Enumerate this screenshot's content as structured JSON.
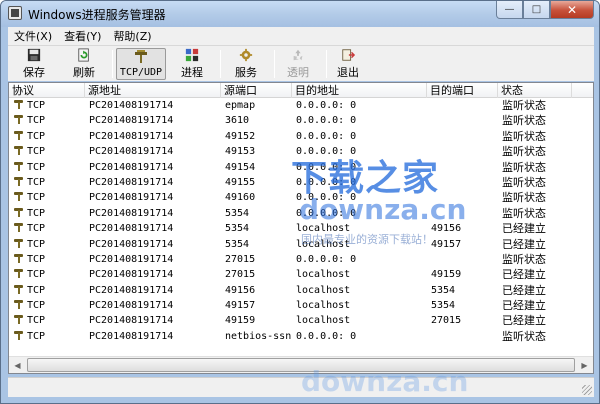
{
  "window": {
    "title": "Windows进程服务管理器"
  },
  "window_buttons": {
    "minimize": "—",
    "maximize": "□",
    "close": "✕"
  },
  "menu": [
    {
      "label": "文件(X)"
    },
    {
      "label": "查看(Y)"
    },
    {
      "label": "帮助(Z)"
    }
  ],
  "toolbar": [
    {
      "label": "保存",
      "icon": "save-icon",
      "state": "normal"
    },
    {
      "label": "刷新",
      "icon": "refresh-icon",
      "state": "normal"
    },
    {
      "label": "TCP/UDP",
      "icon": "network-icon",
      "state": "pressed"
    },
    {
      "label": "进程",
      "icon": "process-icon",
      "state": "normal"
    },
    {
      "label": "服务",
      "icon": "service-icon",
      "state": "normal"
    },
    {
      "label": "透明",
      "icon": "transparency-icon",
      "state": "disabled"
    },
    {
      "label": "退出",
      "icon": "exit-icon",
      "state": "normal"
    }
  ],
  "table": {
    "columns": [
      "协议",
      "源地址",
      "源端口",
      "目的地址",
      "目的端口",
      "状态"
    ],
    "rows": [
      [
        "TCP",
        "PC201408191714",
        "epmap",
        "0.0.0.0: 0",
        "",
        "监听状态"
      ],
      [
        "TCP",
        "PC201408191714",
        "3610",
        "0.0.0.0: 0",
        "",
        "监听状态"
      ],
      [
        "TCP",
        "PC201408191714",
        "49152",
        "0.0.0.0: 0",
        "",
        "监听状态"
      ],
      [
        "TCP",
        "PC201408191714",
        "49153",
        "0.0.0.0: 0",
        "",
        "监听状态"
      ],
      [
        "TCP",
        "PC201408191714",
        "49154",
        "0.0.0.0: 0",
        "",
        "监听状态"
      ],
      [
        "TCP",
        "PC201408191714",
        "49155",
        "0.0.0.0: 0",
        "",
        "监听状态"
      ],
      [
        "TCP",
        "PC201408191714",
        "49160",
        "0.0.0.0: 0",
        "",
        "监听状态"
      ],
      [
        "TCP",
        "PC201408191714",
        "5354",
        "0.0.0.0: 0",
        "",
        "监听状态"
      ],
      [
        "TCP",
        "PC201408191714",
        "5354",
        "localhost",
        "49156",
        "已经建立"
      ],
      [
        "TCP",
        "PC201408191714",
        "5354",
        "localhost",
        "49157",
        "已经建立"
      ],
      [
        "TCP",
        "PC201408191714",
        "27015",
        "0.0.0.0: 0",
        "",
        "监听状态"
      ],
      [
        "TCP",
        "PC201408191714",
        "27015",
        "localhost",
        "49159",
        "已经建立"
      ],
      [
        "TCP",
        "PC201408191714",
        "49156",
        "localhost",
        "5354",
        "已经建立"
      ],
      [
        "TCP",
        "PC201408191714",
        "49157",
        "localhost",
        "5354",
        "已经建立"
      ],
      [
        "TCP",
        "PC201408191714",
        "49159",
        "localhost",
        "27015",
        "已经建立"
      ],
      [
        "TCP",
        "PC201408191714",
        "netbios-ssn",
        "0.0.0.0: 0",
        "",
        "监听状态"
      ]
    ]
  },
  "watermark": {
    "main": "下载之家",
    "url": "downza.cn",
    "sub": "国内最专业的资源下载站！",
    "bottom": "downza.cn"
  }
}
